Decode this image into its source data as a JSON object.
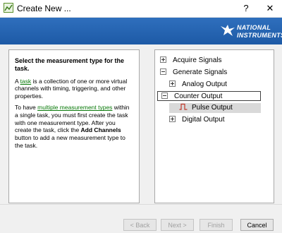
{
  "window": {
    "title": "Create New ...",
    "help_glyph": "?",
    "close_glyph": "✕"
  },
  "banner": {
    "logo_line1": "NATIONAL",
    "logo_line2": "INSTRUMENTS"
  },
  "help": {
    "heading": "Select the measurement type for the task.",
    "p1_pre": "A ",
    "p1_link": "task",
    "p1_post": " is a collection of one or more virtual channels with timing, triggering, and other properties.",
    "p2_pre": "To have ",
    "p2_link": "multiple measurement types",
    "p2_mid": " within a single task, you must first create the task with one measurement type. After you create the task, click the ",
    "p2_bold": "Add Channels",
    "p2_post": " button to add a new measurement type to the task."
  },
  "tree": {
    "acquire": "Acquire Signals",
    "generate": "Generate Signals",
    "analog": "Analog Output",
    "counter": "Counter Output",
    "pulse": "Pulse Output",
    "digital": "Digital Output"
  },
  "buttons": {
    "back": "< Back",
    "next": "Next >",
    "finish": "Finish",
    "cancel": "Cancel"
  }
}
